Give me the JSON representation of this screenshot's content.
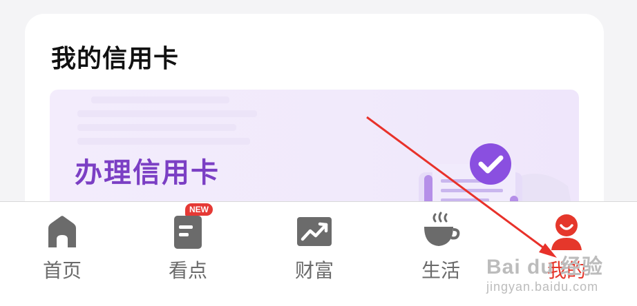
{
  "card": {
    "title": "我的信用卡",
    "banner": {
      "title": "办理信用卡",
      "illustration": "document-check-icon"
    }
  },
  "tabs": [
    {
      "label": "首页",
      "icon": "home-icon",
      "active": false
    },
    {
      "label": "看点",
      "icon": "news-icon",
      "active": false,
      "badge": "NEW"
    },
    {
      "label": "财富",
      "icon": "trend-chart-icon",
      "active": false
    },
    {
      "label": "生活",
      "icon": "coffee-cup-icon",
      "active": false
    },
    {
      "label": "我的",
      "icon": "user-icon",
      "active": true
    }
  ],
  "colors": {
    "accent_active": "#e5372b",
    "banner_text": "#7b3fc4",
    "tab_icon": "#6b6b6b",
    "badge": "#e53935"
  },
  "watermark": {
    "brand": "Bai du 经验",
    "domain": "jingyan.baidu.com"
  }
}
